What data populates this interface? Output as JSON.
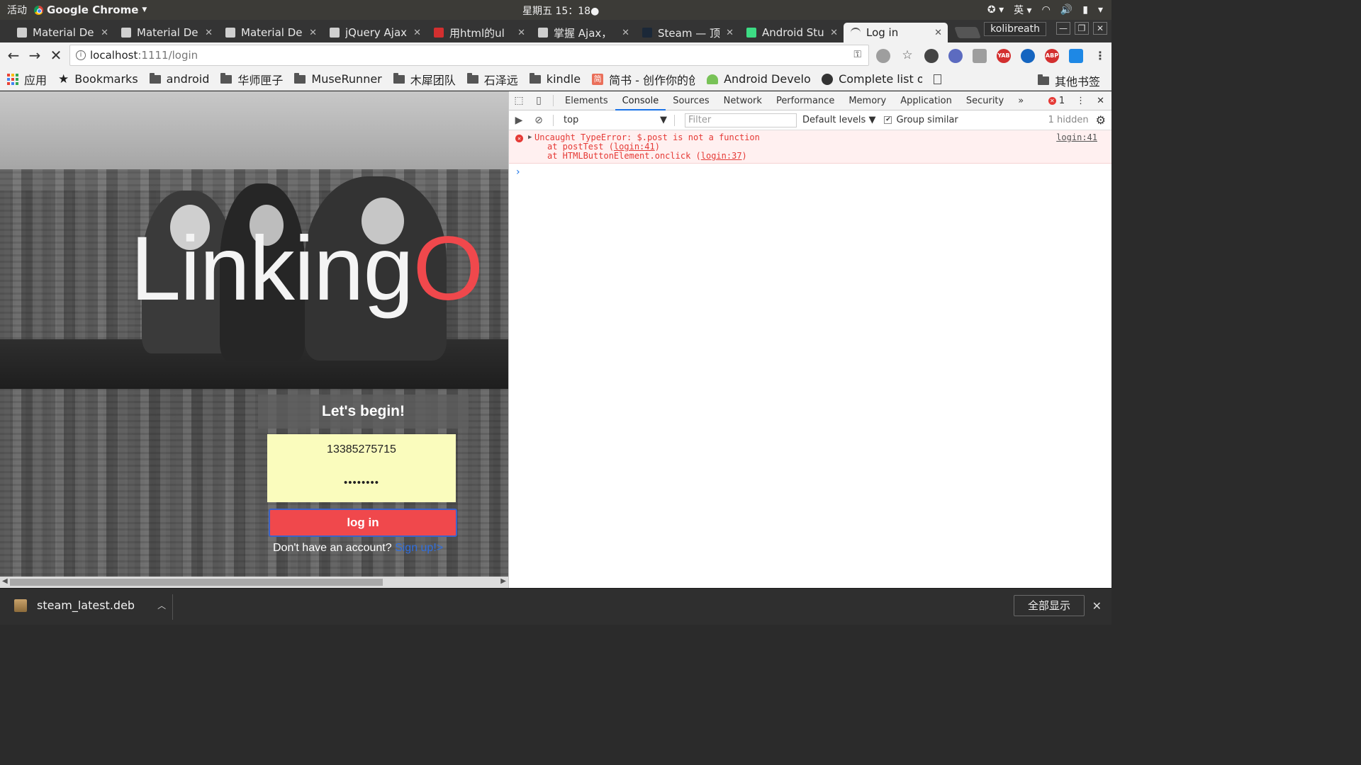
{
  "system": {
    "activities": "活动",
    "app_name": "Google Chrome",
    "clock": "星期五 15：18●",
    "input_method": "英"
  },
  "tabs": [
    {
      "title": "Material De",
      "fav": "#666666"
    },
    {
      "title": "Material De",
      "fav": "#777777"
    },
    {
      "title": "Material De",
      "fav": "#777777"
    },
    {
      "title": "jQuery Ajax",
      "fav": "#555555"
    },
    {
      "title": "用html的ul",
      "fav": "#d32f2f"
    },
    {
      "title": "掌握 Ajax，",
      "fav": "#444444"
    },
    {
      "title": "Steam — 顶",
      "fav": "#1b2838"
    },
    {
      "title": "Android Stu",
      "fav": "#3ddc84"
    },
    {
      "title": "Log in",
      "fav": "#f2f2f2"
    }
  ],
  "profile_name": "kolibreath",
  "toolbar": {
    "url_host": "localhost",
    "url_path": ":1111/login"
  },
  "extensions": [
    {
      "label": "",
      "color": "#9e9e9e"
    },
    {
      "label": "",
      "color": "#f2f2f2"
    },
    {
      "label": "",
      "color": "#444444"
    },
    {
      "label": "",
      "color": "#5c6bc0"
    },
    {
      "label": "",
      "color": "#9e9e9e"
    },
    {
      "label": "YAB",
      "color": "#d32f2f"
    },
    {
      "label": "",
      "color": "#1565c0"
    },
    {
      "label": "ABP",
      "color": "#d32f2f"
    },
    {
      "label": "",
      "color": "#1e88e5"
    }
  ],
  "bookmarks": [
    {
      "label": "应用",
      "icon": "apps-grid-icon"
    },
    {
      "label": "Bookmarks",
      "icon": "star-icon"
    },
    {
      "label": "android",
      "icon": "folder-icon"
    },
    {
      "label": "华师匣子",
      "icon": "folder-icon"
    },
    {
      "label": "MuseRunner",
      "icon": "folder-icon"
    },
    {
      "label": "木犀团队",
      "icon": "folder-icon"
    },
    {
      "label": "石泽远",
      "icon": "folder-icon"
    },
    {
      "label": "kindle",
      "icon": "folder-icon"
    },
    {
      "label": "简书 - 创作你的创",
      "icon": "jianshu-icon"
    },
    {
      "label": "Android Develop",
      "icon": "android-icon"
    },
    {
      "label": "Complete list of",
      "icon": "github-icon"
    }
  ],
  "other_bookmarks": "其他书签",
  "page": {
    "logo_main": "Linking",
    "logo_accent": "O",
    "accent_color": "#f0484c",
    "panel_title": "Let's begin!",
    "phone_value": "13385275715",
    "password_value": "••••••••",
    "login_label": "log in",
    "no_account_text": "Don't have an account? ",
    "signup_link": "Sign up!>"
  },
  "devtools": {
    "tabs": [
      "Elements",
      "Console",
      "Sources",
      "Network",
      "Performance",
      "Memory",
      "Application",
      "Security"
    ],
    "active_tab": "Console",
    "error_count": "1",
    "context": "top",
    "filter_placeholder": "Filter",
    "levels": "Default levels",
    "group_similar": "Group similar",
    "hidden_count": "1 hidden",
    "error": {
      "message": "Uncaught TypeError: $.post is not a function",
      "trace1_prefix": "at postTest (",
      "trace1_link": "login:41",
      "trace2_prefix": "at HTMLButtonElement.onclick (",
      "trace2_link": "login:37",
      "source": "login:41"
    }
  },
  "downloads": {
    "filename": "steam_latest.deb",
    "show_all": "全部显示"
  }
}
